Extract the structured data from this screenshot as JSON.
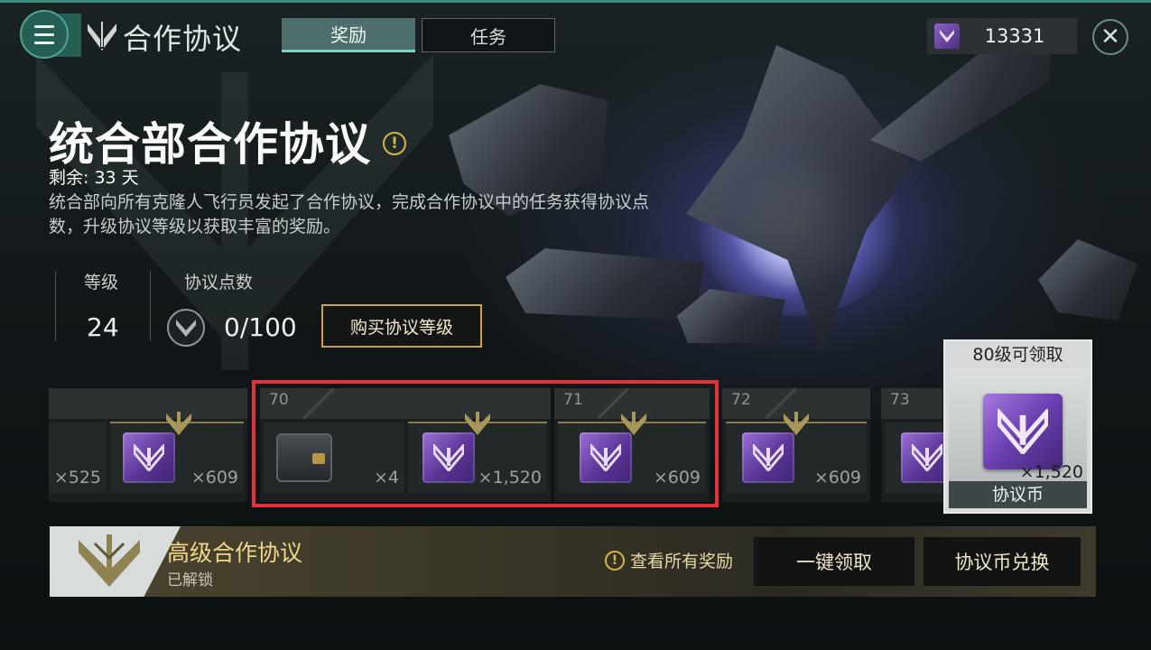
{
  "header": {
    "title": "合作协议",
    "tabs": [
      {
        "label": "奖励",
        "active": true
      },
      {
        "label": "任务",
        "active": false
      }
    ],
    "currency_value": "13331"
  },
  "agreement": {
    "title": "统合部合作协议",
    "remaining": "剩余: 33 天",
    "description": "统合部向所有克隆人飞行员发起了合作协议，完成合作协议中的任务获得协议点数，升级协议等级以获取丰富的奖励。",
    "level_label": "等级",
    "level_value": "24",
    "points_label": "协议点数",
    "points_value": "0/100",
    "buy_button": "购买协议等级"
  },
  "reward_levels": [
    {
      "level": "",
      "free_count": "×525",
      "premium_count": "×609"
    },
    {
      "level": "70",
      "free_count": "×4",
      "premium_count": "×1,520"
    },
    {
      "level": "71",
      "free_count": "",
      "premium_count": "×609"
    },
    {
      "level": "72",
      "free_count": "",
      "premium_count": "×609"
    },
    {
      "level": "73",
      "free_count": "",
      "premium_count": ""
    }
  ],
  "preview": {
    "header": "80级可领取",
    "count": "×1,520",
    "name": "协议币"
  },
  "premium": {
    "title": "高级合作协议",
    "status": "已解锁",
    "view_all": "查看所有奖励",
    "claim_all_button": "一键领取",
    "exchange_button": "协议币兑换"
  },
  "colors": {
    "accent_teal": "#255e55",
    "gold": "#c9a24c",
    "highlight_red": "#e53236",
    "purple_card": "#5a3595"
  }
}
